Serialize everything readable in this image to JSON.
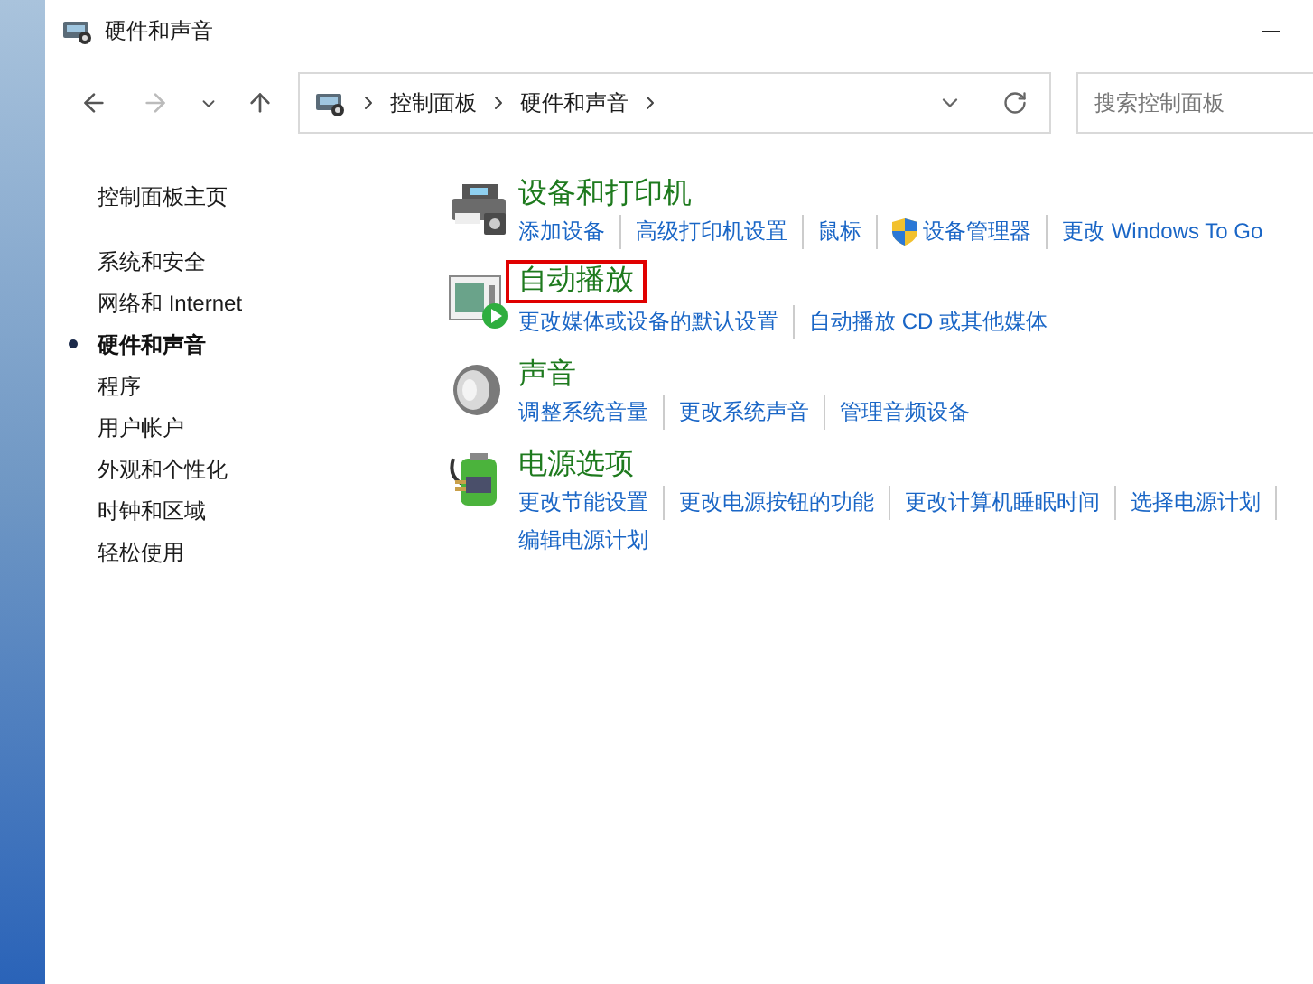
{
  "window": {
    "title": "硬件和声音"
  },
  "address_bar": {
    "crumbs": [
      "控制面板",
      "硬件和声音"
    ]
  },
  "search": {
    "placeholder": "搜索控制面板"
  },
  "nav": {
    "back_disabled": false,
    "forward_disabled": true
  },
  "sidebar": {
    "home": "控制面板主页",
    "items": [
      {
        "label": "系统和安全",
        "selected": false
      },
      {
        "label": "网络和 Internet",
        "selected": false
      },
      {
        "label": "硬件和声音",
        "selected": true
      },
      {
        "label": "程序",
        "selected": false
      },
      {
        "label": "用户帐户",
        "selected": false
      },
      {
        "label": "外观和个性化",
        "selected": false
      },
      {
        "label": "时钟和区域",
        "selected": false
      },
      {
        "label": "轻松使用",
        "selected": false
      }
    ]
  },
  "sections": [
    {
      "kind": "printer",
      "title": "设备和打印机",
      "highlighted": false,
      "links": [
        {
          "kind": "plain",
          "label": "添加设备"
        },
        {
          "kind": "plain",
          "label": "高级打印机设置"
        },
        {
          "kind": "plain",
          "label": "鼠标"
        },
        {
          "kind": "admin",
          "label": "设备管理器"
        },
        {
          "kind": "plain",
          "label": "更改 Windows To Go"
        }
      ]
    },
    {
      "kind": "autoplay",
      "title": "自动播放",
      "highlighted": true,
      "links": [
        {
          "kind": "plain",
          "label": "更改媒体或设备的默认设置"
        },
        {
          "kind": "plain",
          "label": "自动播放 CD 或其他媒体"
        }
      ]
    },
    {
      "kind": "speaker",
      "title": "声音",
      "highlighted": false,
      "links": [
        {
          "kind": "plain",
          "label": "调整系统音量"
        },
        {
          "kind": "plain",
          "label": "更改系统声音"
        },
        {
          "kind": "plain",
          "label": "管理音频设备"
        }
      ]
    },
    {
      "kind": "battery",
      "title": "电源选项",
      "highlighted": false,
      "links": [
        {
          "kind": "plain",
          "label": "更改节能设置"
        },
        {
          "kind": "plain",
          "label": "更改电源按钮的功能"
        },
        {
          "kind": "plain",
          "label": "更改计算机睡眠时间"
        },
        {
          "kind": "plain",
          "label": "选择电源计划"
        },
        {
          "kind": "plain",
          "label": "编辑电源计划"
        }
      ]
    }
  ]
}
